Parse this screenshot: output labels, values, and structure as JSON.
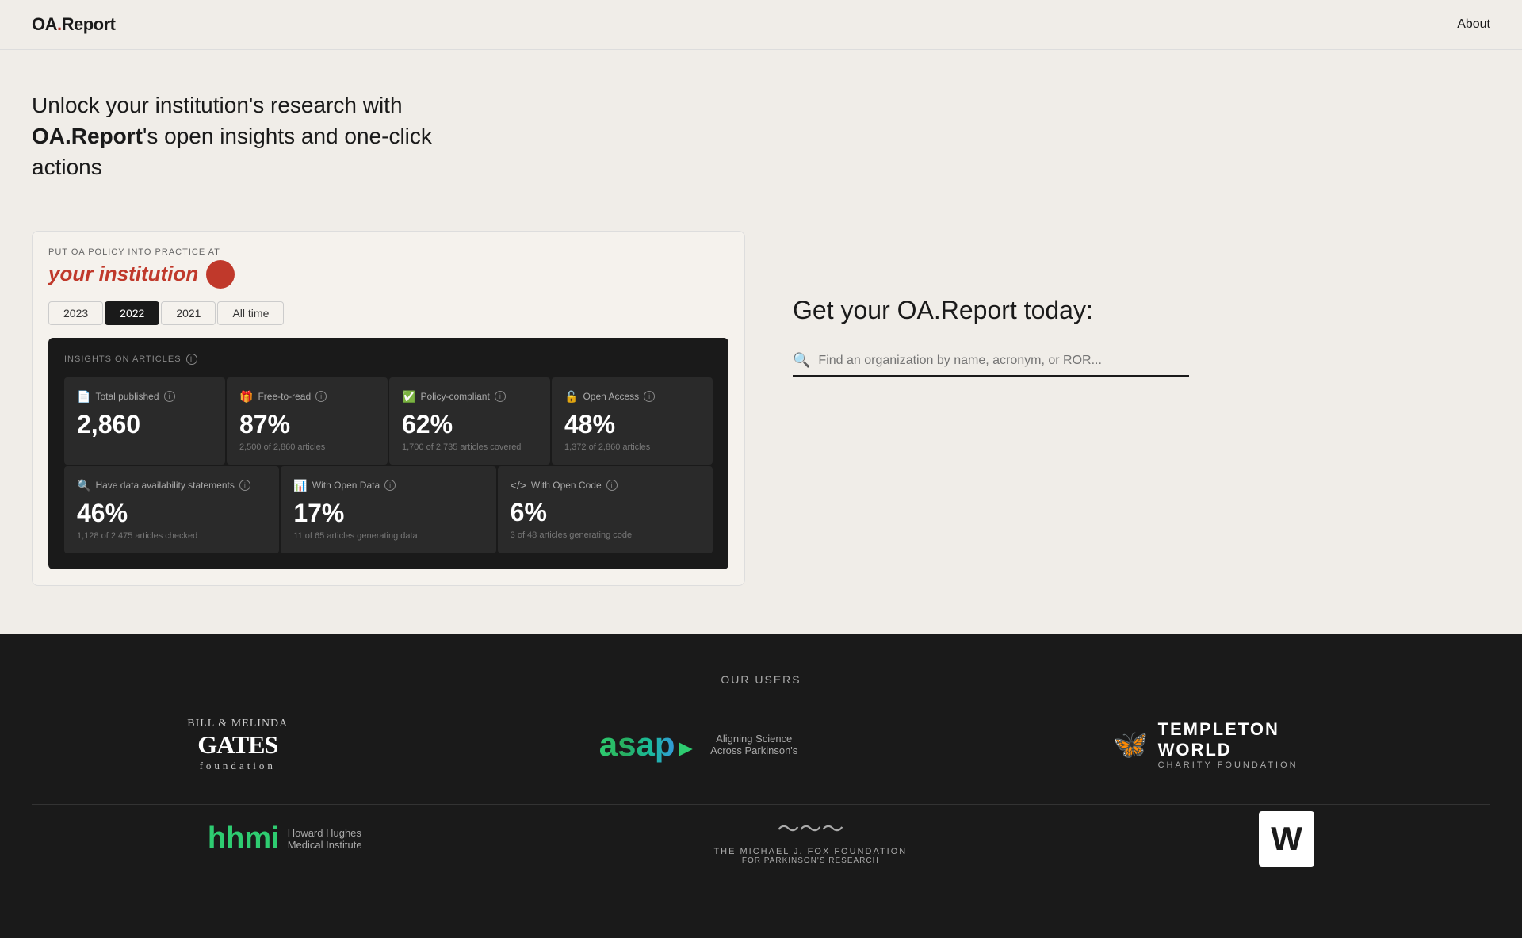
{
  "header": {
    "logo_prefix": "OA",
    "logo_suffix": "Report",
    "about_label": "About"
  },
  "hero": {
    "title_plain": "Unlock your institution's research with ",
    "title_brand": "OA.Report",
    "title_suffix": "'s open insights and one-click actions"
  },
  "dashboard": {
    "put_oa_label": "PUT OA POLICY INTO PRACTICE AT",
    "institution_name": "your institution",
    "tabs": [
      {
        "label": "2023",
        "active": false
      },
      {
        "label": "2022",
        "active": true
      },
      {
        "label": "2021",
        "active": false
      },
      {
        "label": "All time",
        "active": false
      }
    ],
    "insights_label": "INSIGHTS ON ARTICLES",
    "stats_top": [
      {
        "icon": "📄",
        "label": "Total published",
        "value": "2,860",
        "sub": ""
      },
      {
        "icon": "🎁",
        "label": "Free-to-read",
        "value": "87%",
        "sub": "2,500 of 2,860 articles"
      },
      {
        "icon": "✅",
        "label": "Policy-compliant",
        "value": "62%",
        "sub": "1,700 of 2,735 articles covered"
      },
      {
        "icon": "🔓",
        "label": "Open Access",
        "value": "48%",
        "sub": "1,372 of 2,860 articles"
      }
    ],
    "stats_bottom": [
      {
        "icon": "🔍",
        "label": "Have data availability statements",
        "value": "46%",
        "sub": "1,128 of 2,475 articles checked"
      },
      {
        "icon": "📊",
        "label": "With Open Data",
        "value": "17%",
        "sub": "11 of 65 articles generating data"
      },
      {
        "icon": "</>",
        "label": "With Open Code",
        "value": "6%",
        "sub": "3 of 48 articles generating code"
      }
    ]
  },
  "right_panel": {
    "title": "Get your OA.Report today:",
    "search_placeholder": "Find an organization by name, acronym, or ROR..."
  },
  "footer": {
    "our_users_label": "OUR USERS",
    "logos": [
      {
        "id": "gates",
        "name": "Bill & Melinda Gates Foundation"
      },
      {
        "id": "asap",
        "name": "Aligning Science Across Parkinson's"
      },
      {
        "id": "templeton",
        "name": "Templeton World Charity Foundation"
      },
      {
        "id": "hhmi",
        "name": "Howard Hughes Medical Institute"
      },
      {
        "id": "mjf",
        "name": "The Michael J. Fox Foundation for Parkinson's Research"
      },
      {
        "id": "wellcome",
        "name": "Wellcome"
      }
    ]
  }
}
